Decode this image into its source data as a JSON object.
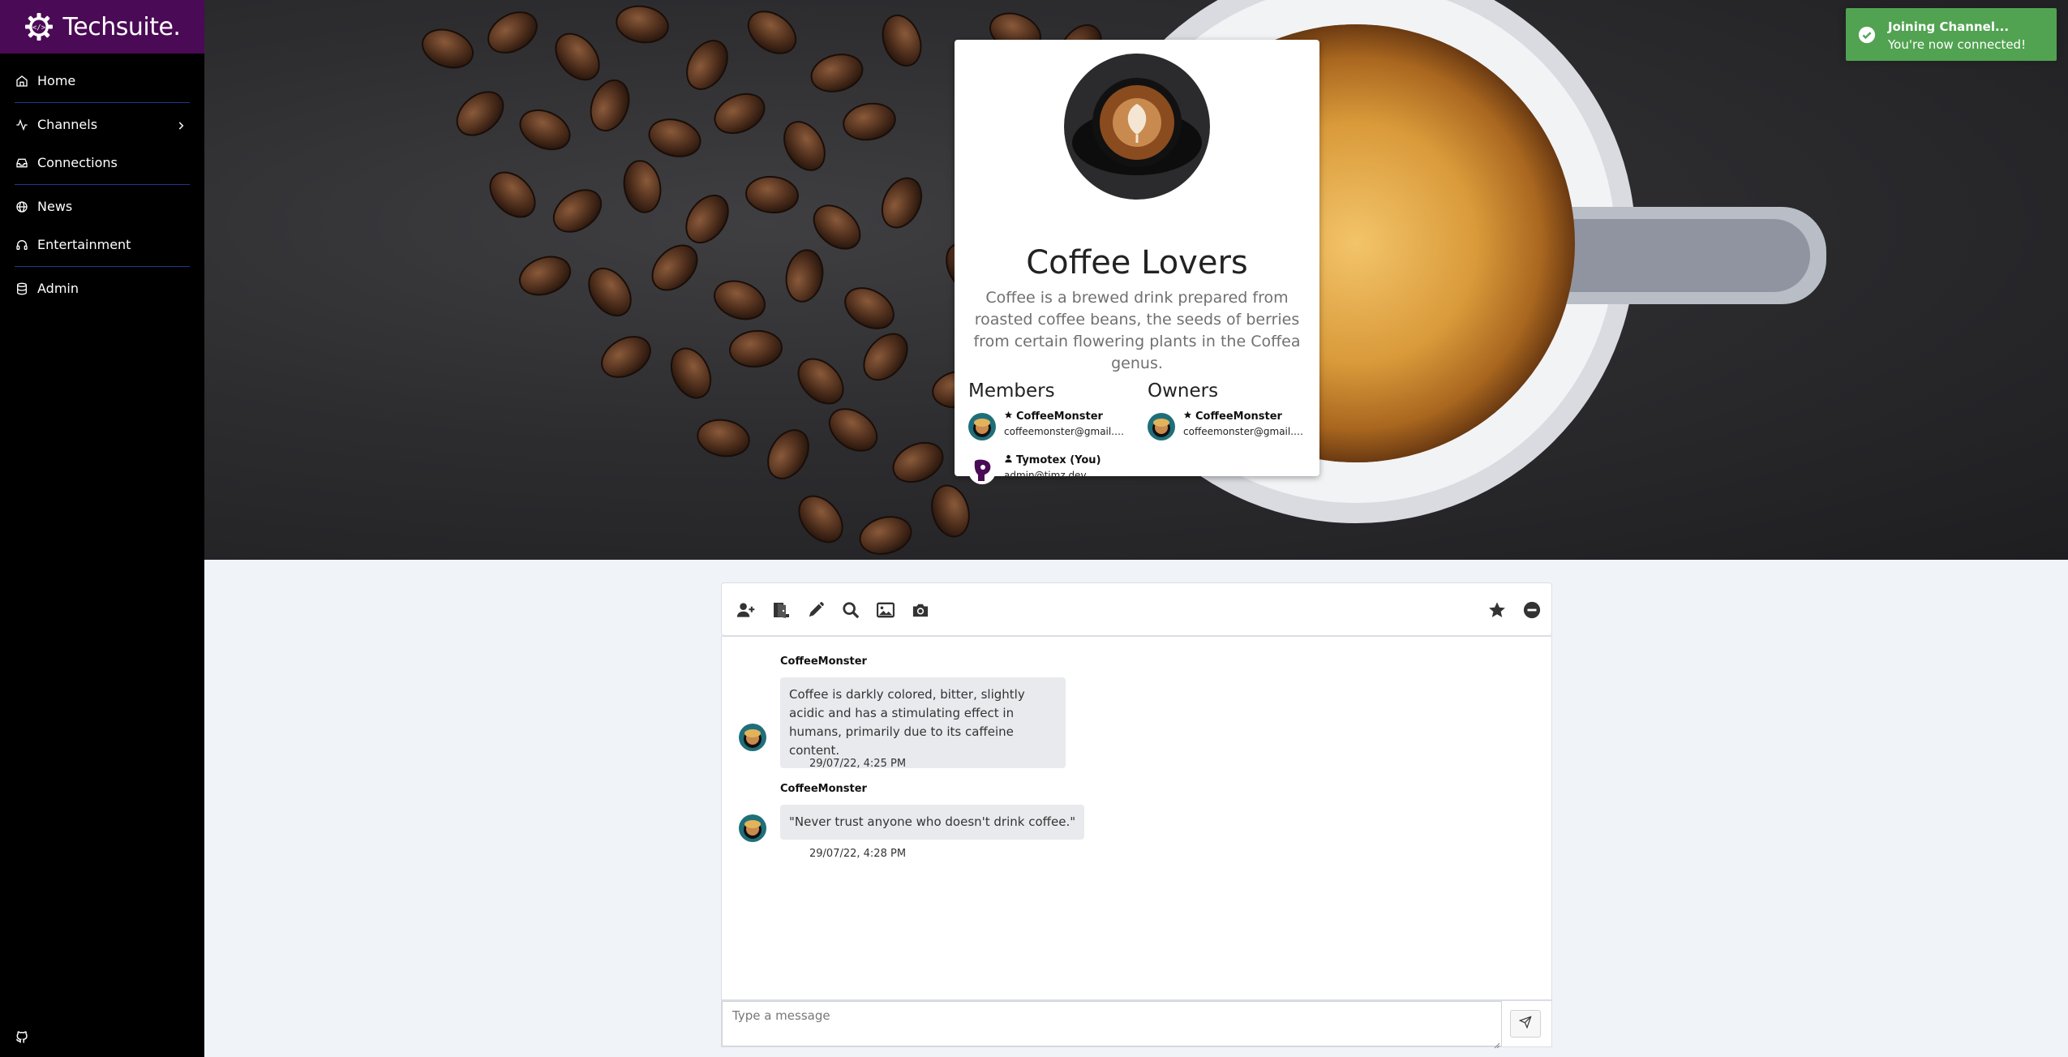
{
  "app": {
    "brand_name": "Techsuite.",
    "brand_color": "#4b0a55"
  },
  "sidebar": {
    "items": [
      {
        "label": "Home",
        "icon": "home-icon"
      },
      {
        "label": "Channels",
        "icon": "activity-icon"
      },
      {
        "label": "Connections",
        "icon": "inbox-icon"
      },
      {
        "label": "News",
        "icon": "globe-icon"
      },
      {
        "label": "Entertainment",
        "icon": "headphones-icon"
      },
      {
        "label": "Admin",
        "icon": "database-icon"
      }
    ],
    "footer_icon": "github-icon"
  },
  "channel": {
    "title": "Coffee Lovers",
    "description": "Coffee is a brewed drink prepared from roasted coffee beans, the seeds of berries from certain flowering plants in the Coffea genus.",
    "members_title": "Members",
    "owners_title": "Owners",
    "members": [
      {
        "name": "CoffeeMonster",
        "email": "coffeemonster@gmail.com",
        "role_icon": "star-icon"
      },
      {
        "name": "Tymotex (You)",
        "email": "admin@timz.dev",
        "role_icon": "user-icon"
      }
    ],
    "owners": [
      {
        "name": "CoffeeMonster",
        "email": "coffeemonster@gmail.com",
        "role_icon": "star-icon"
      }
    ]
  },
  "toast": {
    "title": "Joining Channel...",
    "message": "You're now connected!",
    "color": "#51a351",
    "icon": "check-circle-icon"
  },
  "toolbar": {
    "left_tools": [
      "invite-user-icon",
      "leave-channel-icon",
      "edit-icon",
      "search-icon",
      "image-icon",
      "camera-icon"
    ],
    "right_tools": [
      "star-icon",
      "minus-circle-icon"
    ]
  },
  "messages": [
    {
      "sender": "CoffeeMonster",
      "text": "Coffee is darkly colored, bitter, slightly acidic and has a stimulating effect in humans, primarily due to its caffeine content.",
      "time": "29/07/22, 4:25 PM"
    },
    {
      "sender": "CoffeeMonster",
      "text": "\"Never trust anyone who doesn't drink coffee.\"",
      "time": "29/07/22, 4:28 PM"
    }
  ],
  "composer": {
    "placeholder": "Type a message"
  }
}
